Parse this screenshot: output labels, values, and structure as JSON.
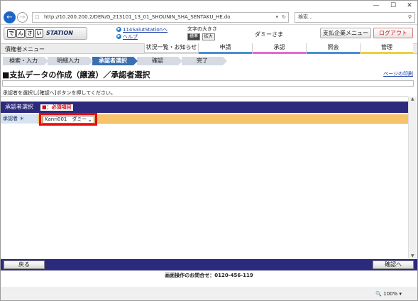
{
  "browser": {
    "address": "http://10.200.200.2/DEN/G_213101_13_01_SHOUNIN_SHA_SENTAKU_HE.do",
    "search_placeholder": "検索...",
    "zoom": "100%",
    "min": "—",
    "max": "☐",
    "close": "✕"
  },
  "header": {
    "logo_chars": [
      "で",
      "ん",
      "さ",
      "い"
    ],
    "logo_text": "STATION",
    "link1": "114SalutStationへ",
    "link2": "ヘルプ",
    "fontsize_label": "文字の大きさ",
    "size_normal": "標準",
    "size_large": "拡大",
    "user": "ダミーさま",
    "btn_menu": "支払企業メニュー",
    "btn_logout": "ログアウト"
  },
  "menu": {
    "heading": "債権者メニュー",
    "tabs": [
      {
        "label": "状況一覧・お知らせ",
        "color": "#d8d8d8"
      },
      {
        "label": "申請",
        "color": "#4a8ed0"
      },
      {
        "label": "承認",
        "color": "#e36ad0"
      },
      {
        "label": "照会",
        "color": "#4a8ed0"
      },
      {
        "label": "管理",
        "color": "#e8d23a"
      }
    ]
  },
  "steps": [
    "検索・入力",
    "明細入力",
    "承認者選択",
    "確認",
    "完了"
  ],
  "page": {
    "title": "■支払データの作成（譲渡）／承認者選択",
    "print_link": "ページの印刷",
    "instruction": "承認者を選択し[確認へ]ボタンを押してください。",
    "section_title": "承認者選択",
    "required_badge": "■：必須項目",
    "field_label": "承認者 ＊",
    "approver_value": "Kanri001　ダミー"
  },
  "footer": {
    "back": "戻る",
    "next": "確認へ",
    "contact": "画面操作のお問合せ：0120-456-119"
  }
}
